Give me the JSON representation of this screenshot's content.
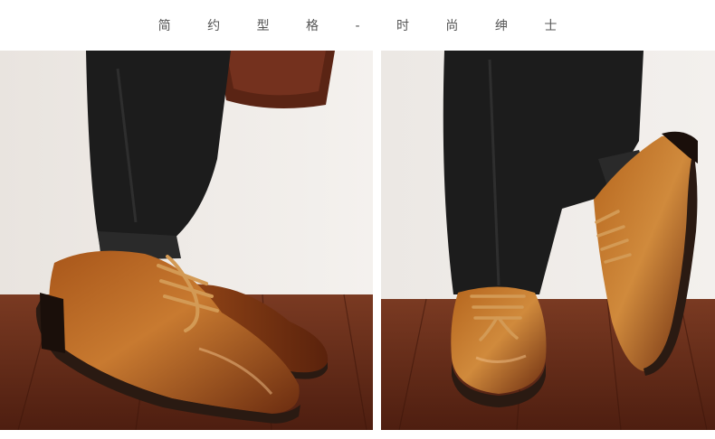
{
  "banner": {
    "title": "简 约 型 格 - 时 尚 绅 士"
  },
  "photos": [
    {
      "subject": "brown leather derby shoe, side view"
    },
    {
      "subject": "pair of brown leather derby shoes, front view"
    }
  ],
  "colors": {
    "background": "#ffffff",
    "wall": "#efebe7",
    "floor": "#6b2a18",
    "leather": "#b5651d",
    "trousers": "#1c1c1c",
    "laces": "#c9914e",
    "sole": "#2a1a12"
  }
}
